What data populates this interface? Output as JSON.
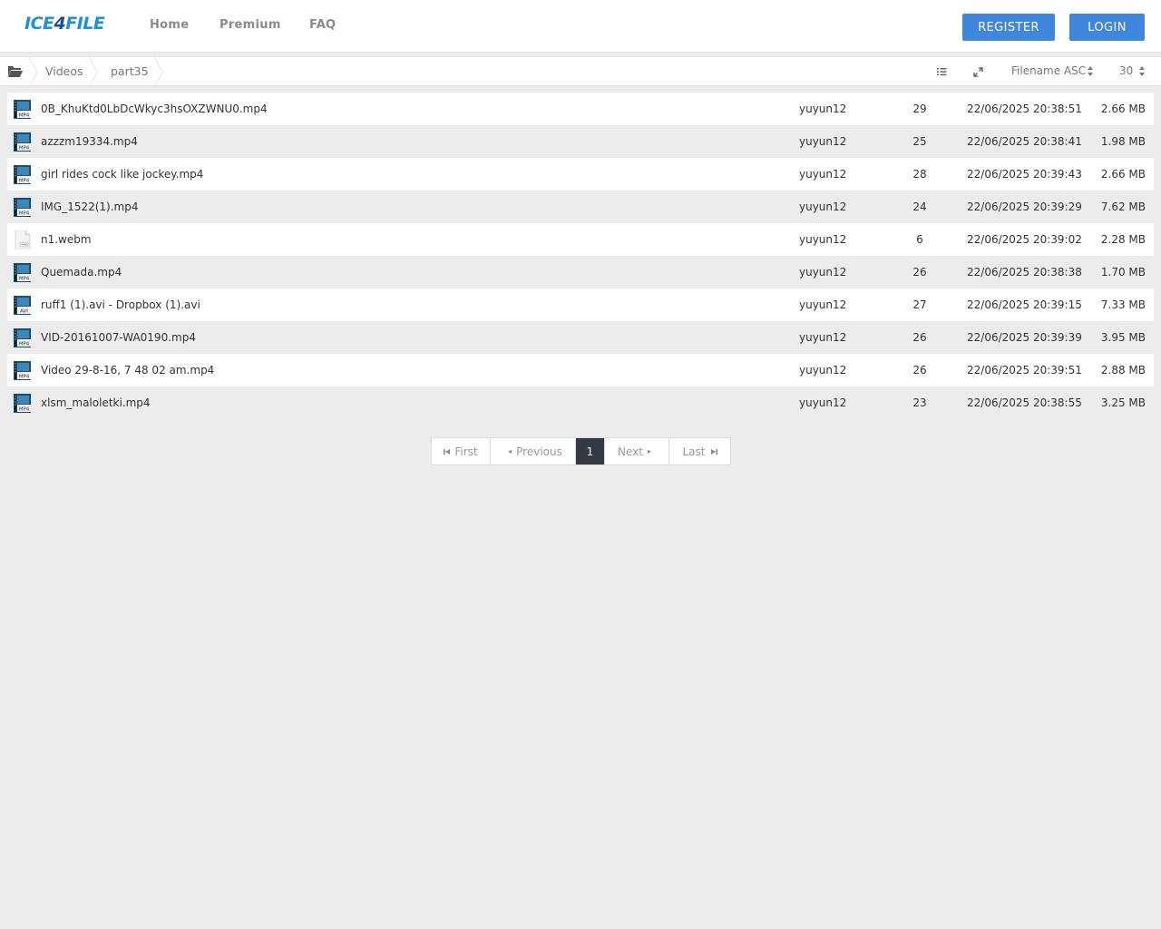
{
  "brand": {
    "logo_light": "ICE",
    "logo_dark": "4",
    "logo_rest": "FILE"
  },
  "nav": {
    "home": "Home",
    "premium": "Premium",
    "faq": "FAQ"
  },
  "auth": {
    "register": "REGISTER",
    "login": "LOGIN"
  },
  "breadcrumb": {
    "items": [
      "Videos",
      "part35"
    ]
  },
  "toolbar": {
    "sort": "Filename ASC",
    "per_page": "30"
  },
  "files": [
    {
      "name": "0B_KhuKtd0LbDcWkyc3hsOXZWNU0.mp4",
      "owner": "yuyun12",
      "count": "29",
      "date": "22/06/2025 20:38:51",
      "size": "2.66 MB",
      "icon": "mp4-file-icon",
      "badge": "MP4"
    },
    {
      "name": "azzzm19334.mp4",
      "owner": "yuyun12",
      "count": "25",
      "date": "22/06/2025 20:38:41",
      "size": "1.98 MB",
      "icon": "mp4-file-icon",
      "badge": "MP4"
    },
    {
      "name": "girl rides cock like jockey.mp4",
      "owner": "yuyun12",
      "count": "28",
      "date": "22/06/2025 20:39:43",
      "size": "2.66 MB",
      "icon": "mp4-file-icon",
      "badge": "MP4"
    },
    {
      "name": "IMG_1522(1).mp4",
      "owner": "yuyun12",
      "count": "24",
      "date": "22/06/2025 20:39:29",
      "size": "7.62 MB",
      "icon": "mp4-file-icon",
      "badge": "MP4"
    },
    {
      "name": "n1.webm",
      "owner": "yuyun12",
      "count": "6",
      "date": "22/06/2025 20:39:02",
      "size": "2.28 MB",
      "icon": "generic-file-icon",
      "badge": ""
    },
    {
      "name": "Quemada.mp4",
      "owner": "yuyun12",
      "count": "26",
      "date": "22/06/2025 20:38:38",
      "size": "1.70 MB",
      "icon": "mp4-file-icon",
      "badge": "MP4"
    },
    {
      "name": "ruff1 (1).avi - Dropbox (1).avi",
      "owner": "yuyun12",
      "count": "27",
      "date": "22/06/2025 20:39:15",
      "size": "7.33 MB",
      "icon": "avi-file-icon",
      "badge": "AVI"
    },
    {
      "name": "VID-20161007-WA0190.mp4",
      "owner": "yuyun12",
      "count": "26",
      "date": "22/06/2025 20:39:39",
      "size": "3.95 MB",
      "icon": "mp4-file-icon",
      "badge": "MP4"
    },
    {
      "name": "Video 29-8-16, 7 48 02 am.mp4",
      "owner": "yuyun12",
      "count": "26",
      "date": "22/06/2025 20:39:51",
      "size": "2.88 MB",
      "icon": "mp4-file-icon",
      "badge": "MP4"
    },
    {
      "name": "xlsm_maloletki.mp4",
      "owner": "yuyun12",
      "count": "23",
      "date": "22/06/2025 20:38:55",
      "size": "3.25 MB",
      "icon": "mp4-file-icon",
      "badge": "MP4"
    }
  ],
  "pagination": {
    "first": "First",
    "previous": "Previous",
    "current": "1",
    "next": "Next",
    "last": "Last"
  },
  "colors": {
    "accent": "#3e87dd",
    "active_page": "#343a45",
    "logo_blue": "#1f8fd6"
  }
}
